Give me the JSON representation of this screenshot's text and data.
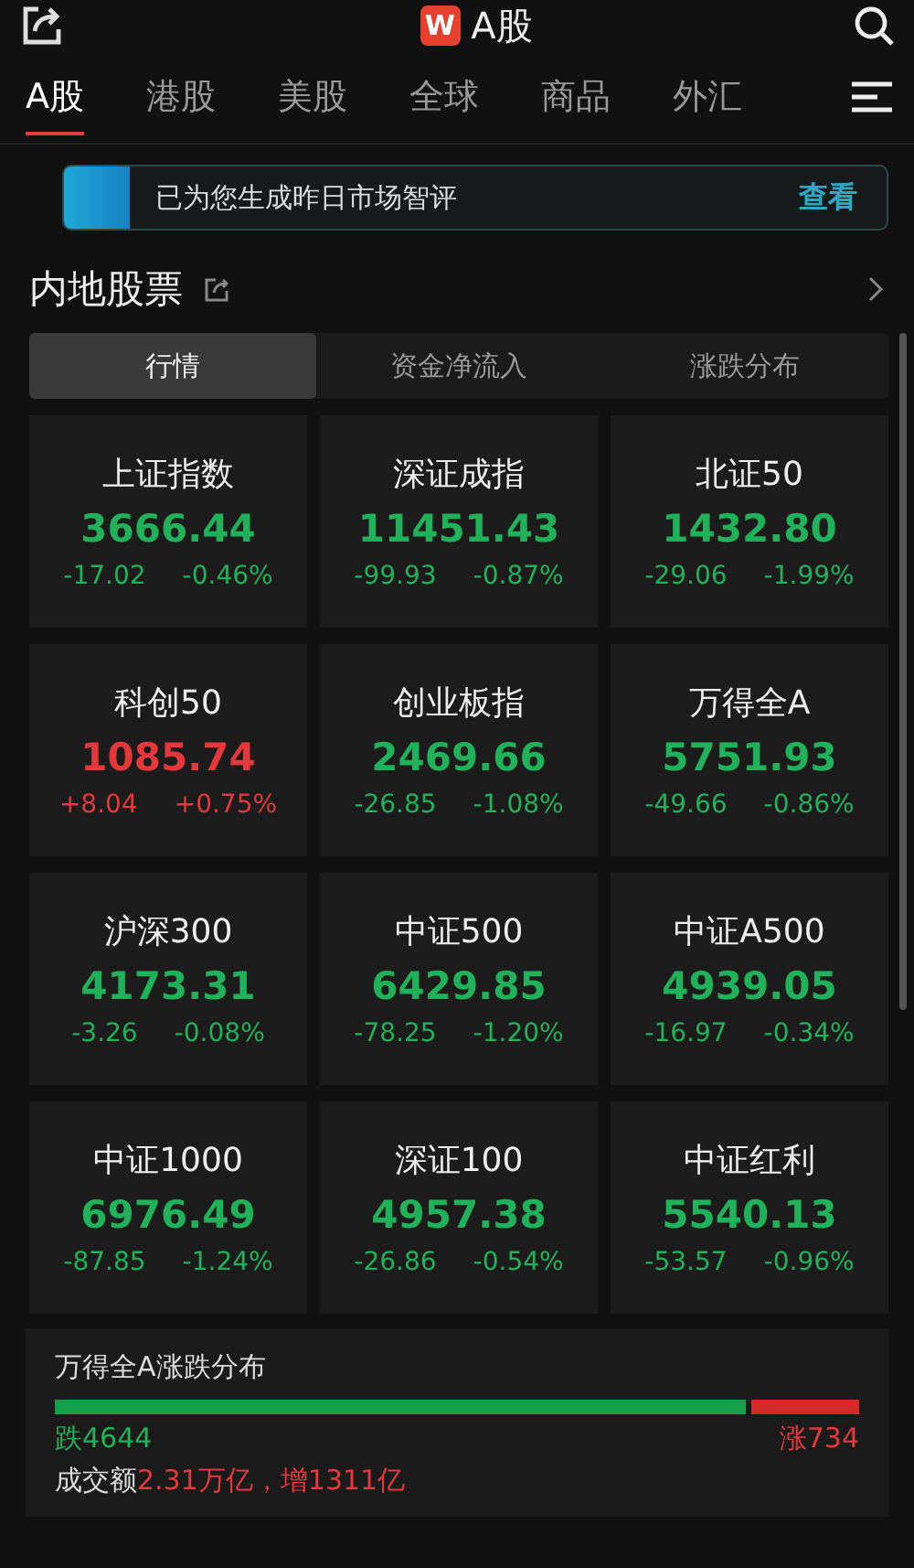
{
  "header": {
    "logo": "W",
    "title": "A股"
  },
  "tabs": [
    {
      "label": "A股",
      "selected": true
    },
    {
      "label": "港股",
      "selected": false
    },
    {
      "label": "美股",
      "selected": false
    },
    {
      "label": "全球",
      "selected": false
    },
    {
      "label": "商品",
      "selected": false
    },
    {
      "label": "外汇",
      "selected": false
    }
  ],
  "banner": {
    "text": "已为您生成昨日市场智评",
    "action": "查看"
  },
  "section": {
    "title": "内地股票"
  },
  "segments": [
    {
      "label": "行情",
      "selected": true
    },
    {
      "label": "资金净流入",
      "selected": false
    },
    {
      "label": "涨跌分布",
      "selected": false
    }
  ],
  "indices": [
    {
      "name": "上证指数",
      "value": "3666.44",
      "change": "-17.02",
      "percent": "-0.46%",
      "color": "#1fb25a"
    },
    {
      "name": "深证成指",
      "value": "11451.43",
      "change": "-99.93",
      "percent": "-0.87%",
      "color": "#1fb25a"
    },
    {
      "name": "北证50",
      "value": "1432.80",
      "change": "-29.06",
      "percent": "-1.99%",
      "color": "#1fb25a"
    },
    {
      "name": "科创50",
      "value": "1085.74",
      "change": "+8.04",
      "percent": "+0.75%",
      "color": "#e5383b"
    },
    {
      "name": "创业板指",
      "value": "2469.66",
      "change": "-26.85",
      "percent": "-1.08%",
      "color": "#1fb25a"
    },
    {
      "name": "万得全A",
      "value": "5751.93",
      "change": "-49.66",
      "percent": "-0.86%",
      "color": "#1fb25a"
    },
    {
      "name": "沪深300",
      "value": "4173.31",
      "change": "-3.26",
      "percent": "-0.08%",
      "color": "#1fb25a"
    },
    {
      "name": "中证500",
      "value": "6429.85",
      "change": "-78.25",
      "percent": "-1.20%",
      "color": "#1fb25a"
    },
    {
      "name": "中证A500",
      "value": "4939.05",
      "change": "-16.97",
      "percent": "-0.34%",
      "color": "#1fb25a"
    },
    {
      "name": "中证1000",
      "value": "6976.49",
      "change": "-87.85",
      "percent": "-1.24%",
      "color": "#1fb25a"
    },
    {
      "name": "深证100",
      "value": "4957.38",
      "change": "-26.86",
      "percent": "-0.54%",
      "color": "#1fb25a"
    },
    {
      "name": "中证红利",
      "value": "5540.13",
      "change": "-53.57",
      "percent": "-0.96%",
      "color": "#1fb25a"
    }
  ],
  "breadth": {
    "title": "万得全A涨跌分布",
    "level": 0.86,
    "down": "跌4644",
    "up": "涨734",
    "turnover_label": "成交额",
    "turnover_value": "2.31万亿，增1311亿"
  }
}
